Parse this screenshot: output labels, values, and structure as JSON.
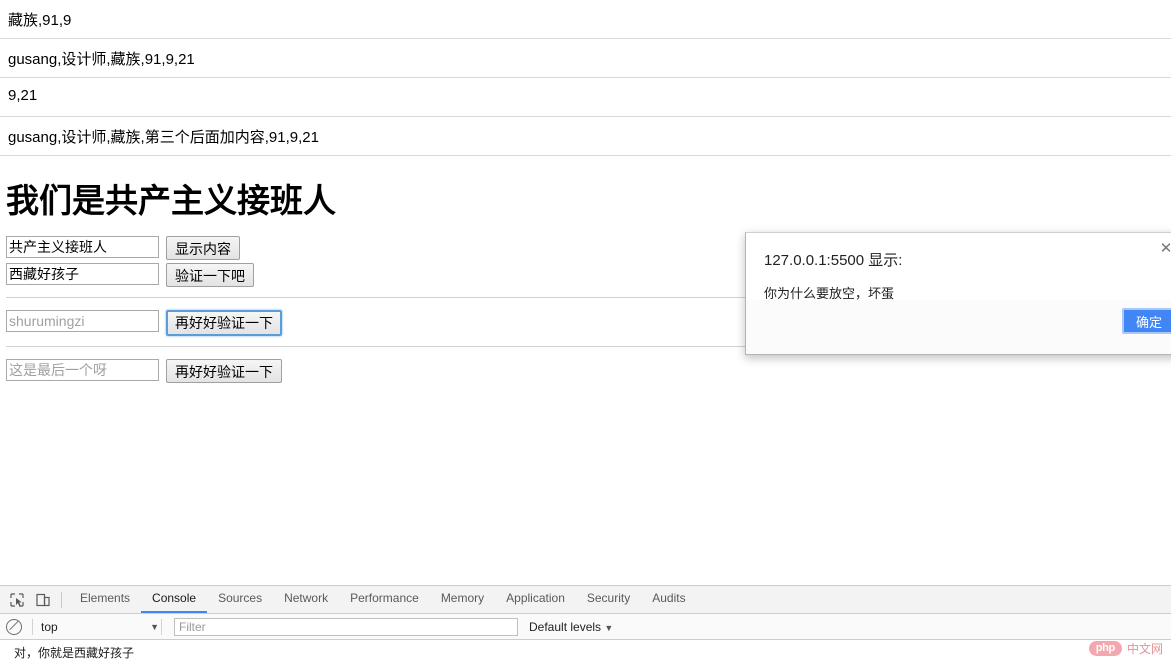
{
  "page": {
    "output_rows": [
      "藏族,91,9",
      "gusang,设计师,藏族,91,9,21",
      "9,21",
      "gusang,设计师,藏族,第三个后面加内容,91,9,21"
    ],
    "title": "我们是共产主义接班人",
    "form": {
      "row1": {
        "value": "共产主义接班人",
        "placeholder": "",
        "button": "显示内容"
      },
      "row2": {
        "value": "西藏好孩子",
        "placeholder": "",
        "button": "验证一下吧"
      },
      "row3": {
        "value": "",
        "placeholder": "shurumingzi",
        "button": "再好好验证一下"
      },
      "row4": {
        "value": "",
        "placeholder": "这是最后一个呀",
        "button": "再好好验证一下"
      }
    }
  },
  "dialog": {
    "origin": "127.0.0.1:5500 显示:",
    "message": "你为什么要放空，坏蛋",
    "ok_label": "确定",
    "close_label": "✕",
    "accent_color": "#4285f4"
  },
  "devtools": {
    "icons": {
      "inspect": "inspect-element-icon",
      "device": "device-toolbar-icon"
    },
    "tabs": [
      {
        "label": "Elements",
        "active": false
      },
      {
        "label": "Console",
        "active": true
      },
      {
        "label": "Sources",
        "active": false
      },
      {
        "label": "Network",
        "active": false
      },
      {
        "label": "Performance",
        "active": false
      },
      {
        "label": "Memory",
        "active": false
      },
      {
        "label": "Application",
        "active": false
      },
      {
        "label": "Security",
        "active": false
      },
      {
        "label": "Audits",
        "active": false
      }
    ],
    "console": {
      "clear_icon": "clear-console-icon",
      "context": "top",
      "context_caret": "▼",
      "filter_placeholder": "Filter",
      "filter_value": "",
      "levels": "Default levels",
      "levels_caret": "▼",
      "messages": [
        "对，你就是西藏好孩子"
      ]
    }
  },
  "watermark": {
    "badge": "php",
    "text": "中文网"
  }
}
